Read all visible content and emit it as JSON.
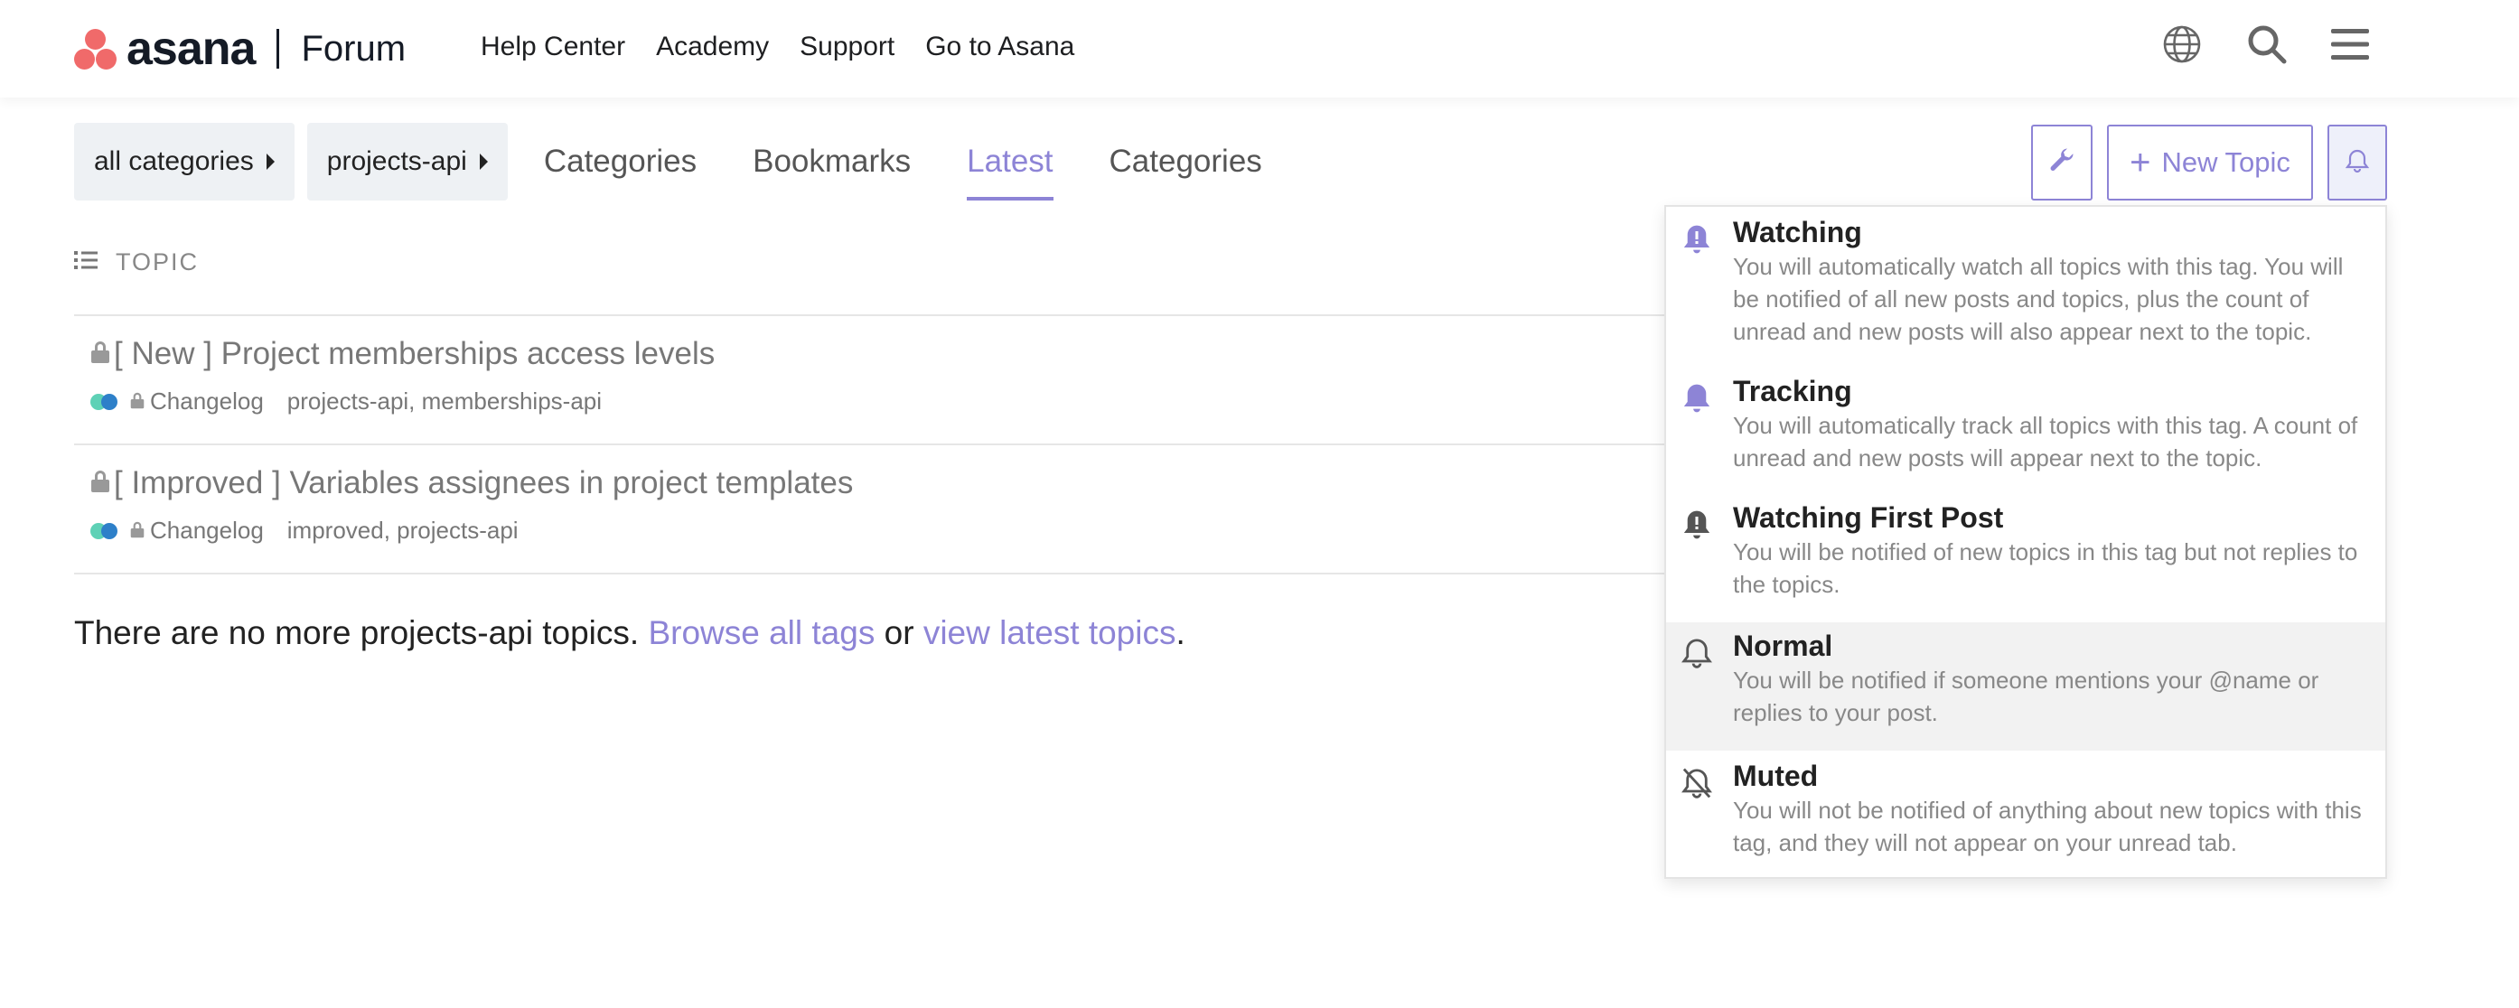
{
  "header": {
    "brand": "asana",
    "section": "Forum",
    "nav": [
      {
        "label": "Help Center"
      },
      {
        "label": "Academy"
      },
      {
        "label": "Support"
      },
      {
        "label": "Go to Asana"
      }
    ],
    "icons": [
      "globe-icon",
      "search-icon",
      "hamburger-menu-icon"
    ]
  },
  "navbar": {
    "breadcrumbs": [
      {
        "label": "all categories"
      },
      {
        "label": "projects-api"
      }
    ],
    "tabs": [
      {
        "label": "Categories",
        "active": false
      },
      {
        "label": "Bookmarks",
        "active": false
      },
      {
        "label": "Latest",
        "active": true
      },
      {
        "label": "Categories",
        "active": false
      }
    ],
    "new_topic_label": "New Topic"
  },
  "list": {
    "column_header": "TOPIC",
    "topics": [
      {
        "title": "[ New ] Project memberships access levels",
        "category": "Changelog",
        "tags": "projects-api, memberships-api"
      },
      {
        "title": "[ Improved ] Variables assignees in project templates",
        "category": "Changelog",
        "tags": "improved, projects-api"
      }
    ],
    "footer": {
      "text_before": "There are no more projects-api topics. ",
      "link1": "Browse all tags",
      "text_mid": " or ",
      "link2": "view latest topics",
      "text_after": "."
    }
  },
  "notification_menu": {
    "options": [
      {
        "title": "Watching",
        "description": "You will automatically watch all topics with this tag. You will be notified of all new posts and topics, plus the count of unread and new posts will also appear next to the topic.",
        "icon": "bell-exclamation-icon"
      },
      {
        "title": "Tracking",
        "description": "You will automatically track all topics with this tag. A count of unread and new posts will appear next to the topic.",
        "icon": "bell-icon"
      },
      {
        "title": "Watching First Post",
        "description": "You will be notified of new topics in this tag but not replies to the topics.",
        "icon": "bell-exclamation-icon"
      },
      {
        "title": "Normal",
        "description": "You will be notified if someone mentions your @name or replies to your post.",
        "icon": "bell-outline-icon"
      },
      {
        "title": "Muted",
        "description": "You will not be notified of anything about new topics with this tag, and they will not appear on your unread tab.",
        "icon": "bell-slash-icon"
      }
    ]
  },
  "colors": {
    "accent": "#8d84d6",
    "brand": "#f06a6a",
    "muted_text": "#888888"
  }
}
